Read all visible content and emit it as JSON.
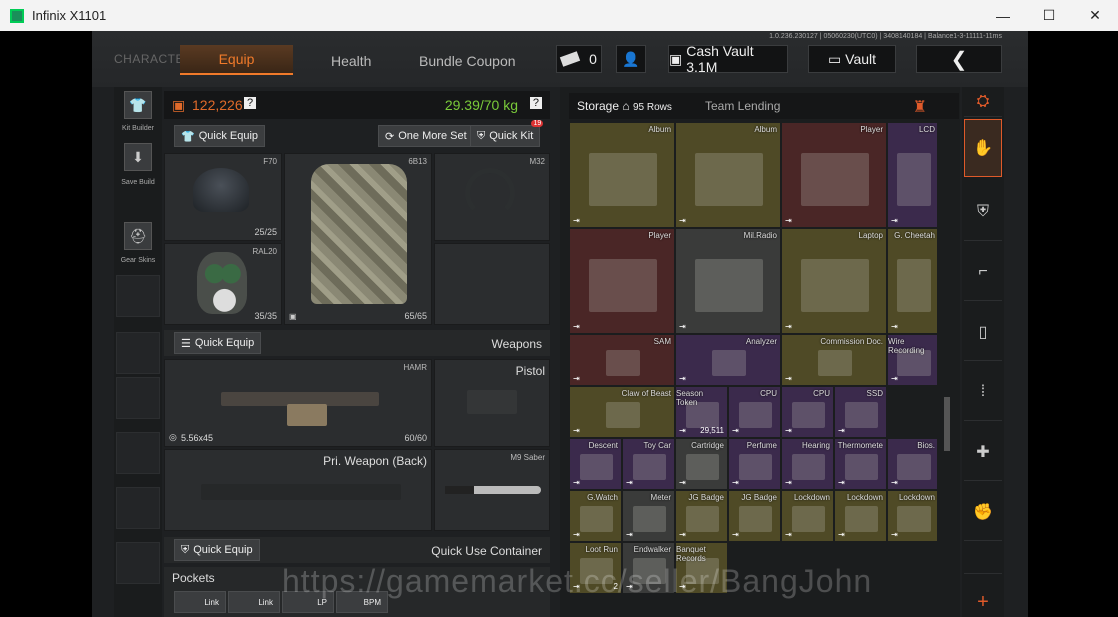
{
  "window": {
    "title": "Infinix X1101",
    "min": "—",
    "max": "☐",
    "close": "✕"
  },
  "version_text": "1.0.236.230127 | 05060230(UTC0) | 3408140184 | Balance1-3-11111-11ms",
  "nav": {
    "character": "CHARACTER",
    "equip": "Equip",
    "health": "Health",
    "bundle": "Bundle Coupon",
    "currency_count": "0",
    "cash_vault": "Cash Vault 3.1M",
    "vault": "Vault",
    "back_icon": "chevron-left-icon"
  },
  "sidebar": {
    "kit_builder": "Kit Builder",
    "save_build": "Save Build",
    "gear_skins": "Gear Skins"
  },
  "equip": {
    "value": "122,226",
    "value_help": "?",
    "weight": "29.39/70 kg",
    "weight_help": "?",
    "quick_equip": "Quick Equip",
    "one_more_set": "One More Set",
    "quick_kit": "Quick Kit",
    "quick_kit_badge": "19",
    "helmet_name": "F70",
    "helmet_dur": "25/25",
    "armor_name": "6B13",
    "armor_dur": "65/65",
    "headset_name": "M32",
    "mask_name": "RAL20",
    "mask_dur": "35/35",
    "weapons_quick_equip": "Quick Equip",
    "weapons_label": "Weapons",
    "primary_name": "HAMR",
    "primary_ammo": "5.56x45",
    "primary_mag": "60/60",
    "pistol_label": "Pistol",
    "back_weapon_label": "Pri. Weapon (Back)",
    "melee_name": "M9 Saber",
    "quick_use_equip": "Quick Equip",
    "quick_use_label": "Quick Use Container",
    "pockets_label": "Pockets",
    "pocket_items": [
      "Link",
      "Link",
      "LP",
      "BPM"
    ]
  },
  "storage": {
    "tab_storage": "Storage",
    "rows": "95 Rows",
    "tab_team": "Team Lending",
    "items": [
      {
        "name": "Album"
      },
      {
        "name": "Album"
      },
      {
        "name": "Player"
      },
      {
        "name": "LCD"
      },
      {
        "name": "Player"
      },
      {
        "name": "Mil.Radio"
      },
      {
        "name": "Laptop"
      },
      {
        "name": "G. Cheetah"
      },
      {
        "name": "SAM"
      },
      {
        "name": "Analyzer"
      },
      {
        "name": "Commission Doc."
      },
      {
        "name": "Wire Recording"
      },
      {
        "name": "Claw of Beast"
      },
      {
        "name": "Season Token",
        "qty": "29,511"
      },
      {
        "name": "CPU"
      },
      {
        "name": "CPU"
      },
      {
        "name": "SSD"
      },
      {
        "name": "Descent"
      },
      {
        "name": "Toy Car"
      },
      {
        "name": "Cartridge"
      },
      {
        "name": "Perfume"
      },
      {
        "name": "Hearing"
      },
      {
        "name": "Thermomete"
      },
      {
        "name": "Bios."
      },
      {
        "name": "G.Watch"
      },
      {
        "name": "Meter"
      },
      {
        "name": "JG Badge"
      },
      {
        "name": "JG Badge"
      },
      {
        "name": "Lockdown"
      },
      {
        "name": "Lockdown"
      },
      {
        "name": "Lockdown"
      },
      {
        "name": "Loot Run",
        "qty": "2"
      },
      {
        "name": "Endwalker"
      },
      {
        "name": "Banquet Records"
      }
    ]
  },
  "watermark": "https://gamemarket.cc/seller/BangJohn"
}
